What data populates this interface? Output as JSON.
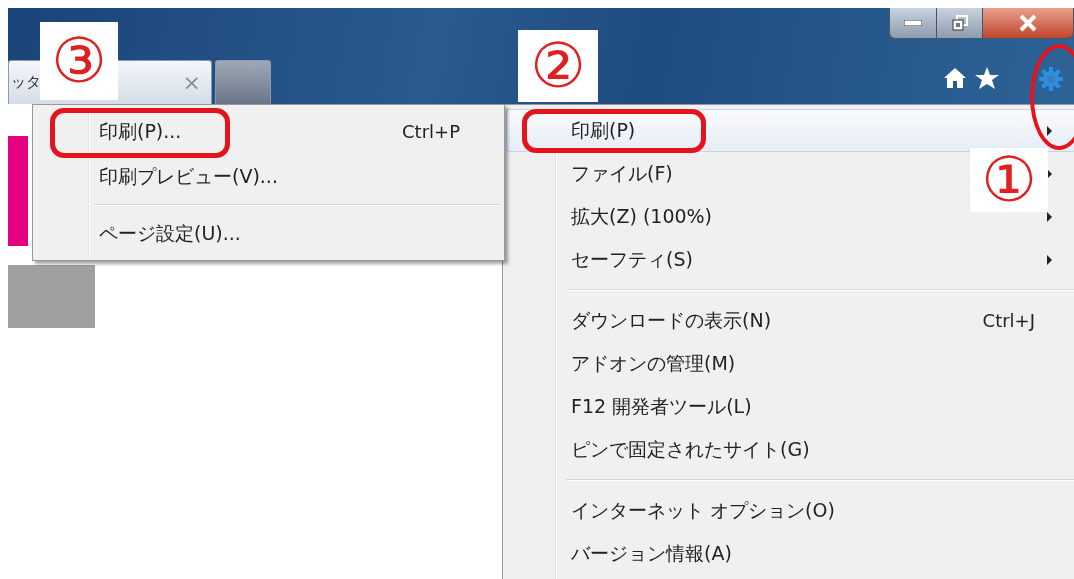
{
  "browser": {
    "tabs": [
      {
        "label": "ッタ",
        "close": "×",
        "selected": true
      },
      {
        "selected": false
      }
    ]
  },
  "submenu": {
    "items": [
      {
        "kind": "item",
        "label": "印刷(P)...",
        "shortcut": "Ctrl+P"
      },
      {
        "kind": "item",
        "label": "印刷プレビュー(V)..."
      },
      {
        "kind": "separator"
      },
      {
        "kind": "item",
        "label": "ページ設定(U)..."
      }
    ]
  },
  "main_menu": {
    "items": [
      {
        "kind": "item",
        "label": "印刷(P)",
        "highlighted": true,
        "has_submenu": true
      },
      {
        "kind": "item",
        "label": "ファイル(F)",
        "highlighted": false,
        "has_submenu": true
      },
      {
        "kind": "item",
        "label": "拡大(Z) (100%)",
        "highlighted": false,
        "has_submenu": true
      },
      {
        "kind": "item",
        "label": "セーフティ(S)",
        "highlighted": false,
        "has_submenu": true
      },
      {
        "kind": "separator"
      },
      {
        "kind": "item",
        "label": "ダウンロードの表示(N)",
        "shortcut": "Ctrl+J",
        "highlighted": false,
        "has_submenu": false
      },
      {
        "kind": "item",
        "label": "アドオンの管理(M)",
        "highlighted": false,
        "has_submenu": false
      },
      {
        "kind": "item",
        "label": "F12 開発者ツール(L)",
        "highlighted": false,
        "has_submenu": false
      },
      {
        "kind": "item",
        "label": "ピンで固定されたサイト(G)",
        "highlighted": false,
        "has_submenu": false
      },
      {
        "kind": "separator"
      },
      {
        "kind": "item",
        "label": "インターネット オプション(O)",
        "highlighted": false,
        "has_submenu": false
      },
      {
        "kind": "item",
        "label": "バージョン情報(A)",
        "highlighted": false,
        "has_submenu": false
      }
    ]
  },
  "annotations": [
    {
      "label": "③"
    },
    {
      "label": "②"
    },
    {
      "label": "①"
    }
  ]
}
